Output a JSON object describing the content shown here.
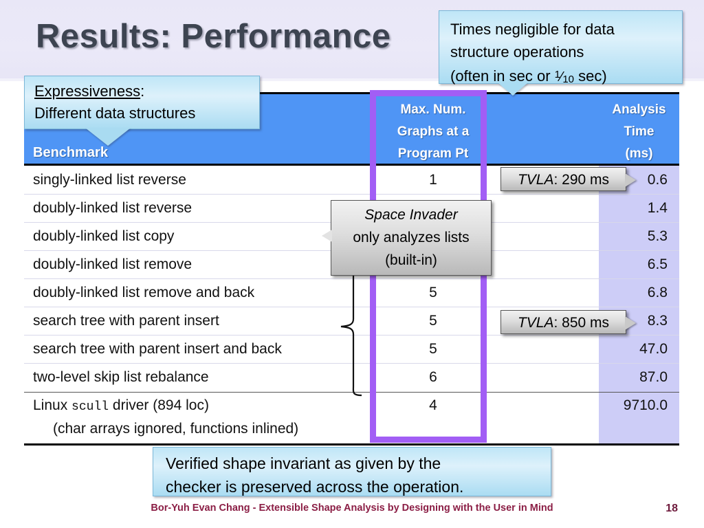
{
  "slide": {
    "title": "Results: Performance",
    "footer_text": "Bor-Yuh Evan Chang - Extensible Shape Analysis by Designing with the User in Mind",
    "page_number": "18"
  },
  "colors": {
    "title_band": "#e9e7f7",
    "header_blue": "#4f95f5",
    "time_column_lavender": "#cdcdf7",
    "highlight_purple": "#a25ef5",
    "callout_blue": "#bfe6f7",
    "callout_gray": "#dddddd",
    "footer_maroon": "#8b1e45",
    "title_gray": "#3d4451"
  },
  "table": {
    "headers": {
      "benchmark": "Benchmark",
      "max_graphs_line1": "Max. Num.",
      "max_graphs_line2": "Graphs at a",
      "max_graphs_line3": "Program Pt",
      "analysis_line1": "Analysis",
      "analysis_line2": "Time",
      "analysis_line3": "(ms)"
    },
    "rows": [
      {
        "benchmark": "singly-linked list reverse",
        "max_graphs": "1",
        "analysis_time": "0.6"
      },
      {
        "benchmark": "doubly-linked list reverse",
        "max_graphs": "",
        "analysis_time": "1.4"
      },
      {
        "benchmark": "doubly-linked list copy",
        "max_graphs": "",
        "analysis_time": "5.3"
      },
      {
        "benchmark": "doubly-linked list remove",
        "max_graphs": "",
        "analysis_time": "6.5"
      },
      {
        "benchmark": "doubly-linked list remove and back",
        "max_graphs": "5",
        "analysis_time": "6.8"
      },
      {
        "benchmark": "search tree with parent insert",
        "max_graphs": "5",
        "analysis_time": "8.3"
      },
      {
        "benchmark": "search tree with parent insert and back",
        "max_graphs": "5",
        "analysis_time": "47.0"
      },
      {
        "benchmark": "two-level skip list rebalance",
        "max_graphs": "6",
        "analysis_time": "87.0"
      }
    ],
    "last_row": {
      "benchmark_pre": "Linux ",
      "benchmark_mono": "scull",
      "benchmark_post": " driver  (894 loc)",
      "benchmark_line2": "(char arrays ignored, functions inlined)",
      "max_graphs": "4",
      "analysis_time": "9710.0"
    }
  },
  "callouts": {
    "times": {
      "line1": "Times negligible for data",
      "line2": "structure operations",
      "line3_pre": "(often in sec or ",
      "line3_num": "1",
      "line3_den": "10",
      "line3_post": " sec)"
    },
    "expressiveness": {
      "heading": "Expressiveness",
      "heading_colon": ":",
      "line2": "Different data structures"
    },
    "space_invader": {
      "line1": "Space Invader",
      "line2": "only analyzes lists",
      "line3": "(built-in)"
    },
    "tvla_1": {
      "name": "TVLA",
      "value": ": 290 ms"
    },
    "tvla_2": {
      "name": "TVLA",
      "value": ": 850 ms"
    },
    "verified": {
      "line1": "Verified shape invariant as given by the",
      "line2": "checker is preserved across the operation."
    }
  }
}
